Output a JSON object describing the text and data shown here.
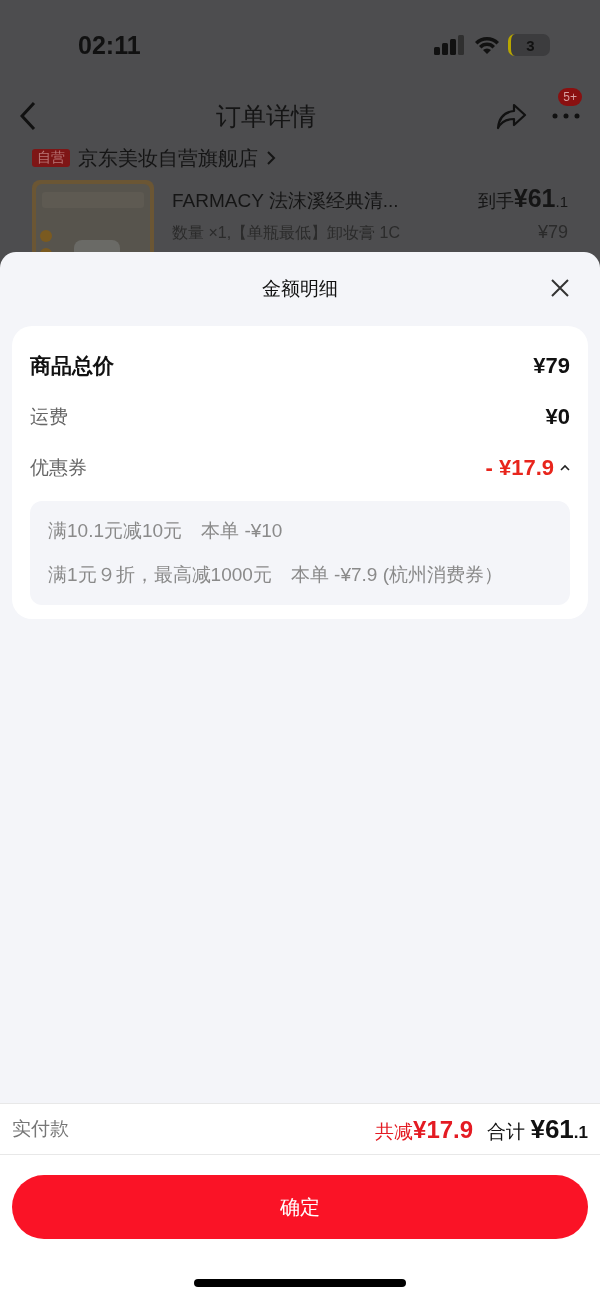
{
  "status_bar": {
    "time": "02:11",
    "battery": "3"
  },
  "nav": {
    "title": "订单详情",
    "badge": "5+"
  },
  "store": {
    "tag": "自营",
    "name": "京东美妆自营旗舰店"
  },
  "product": {
    "title": "FARMACY 法沫溪经典清...",
    "spec": "数量 ×1,【单瓶最低】卸妆膏 1C",
    "price_label": "到手",
    "price_integer": "¥61",
    "price_decimal": ".1",
    "original_price": "¥79"
  },
  "sheet": {
    "title": "金额明细",
    "rows": [
      {
        "kind": "total",
        "label": "商品总价",
        "value": "¥79"
      },
      {
        "kind": "normal",
        "label": "运费",
        "value": "¥0"
      },
      {
        "kind": "discount",
        "label": "优惠券",
        "value": "- ¥17.9",
        "expanded": true
      }
    ],
    "details": [
      "满10.1元减10元　本单 -¥10",
      "满1元９折，最高减1000元　本单 -¥7.9 (杭州消费券）"
    ]
  },
  "footer": {
    "label": "实付款",
    "saved_label": "共减",
    "saved_value": "¥17.9",
    "total_label": "合计",
    "total_integer": "¥61",
    "total_decimal": ".1"
  },
  "buttons": [
    "确定"
  ]
}
